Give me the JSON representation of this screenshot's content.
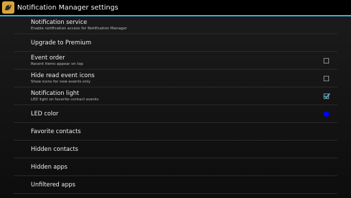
{
  "app": {
    "title": "Notification Manager settings",
    "icon": "app-logo-icon"
  },
  "settings": [
    {
      "key": "notification_service",
      "title": "Notification service",
      "summary": "Enable notification access for Notification Manager"
    },
    {
      "key": "upgrade",
      "title": "Upgrade to Premium"
    },
    {
      "key": "event_order",
      "title": "Event order",
      "summary": "Recent items appear on top",
      "control": "checkbox",
      "checked": false
    },
    {
      "key": "hide_read",
      "title": "Hide read event icons",
      "summary": "Show icons for new events only",
      "control": "checkbox",
      "checked": false
    },
    {
      "key": "notification_light",
      "title": "Notification light",
      "summary": "LED light on favorite contact events",
      "control": "checkbox",
      "checked": true
    },
    {
      "key": "led_color",
      "title": "LED color",
      "control": "color",
      "color": "#0000ff"
    },
    {
      "key": "favorite_contacts",
      "title": "Favorite contacts"
    },
    {
      "key": "hidden_contacts",
      "title": "Hidden contacts"
    },
    {
      "key": "hidden_apps",
      "title": "Hidden apps"
    },
    {
      "key": "unfiltered_apps",
      "title": "Unfiltered apps"
    }
  ],
  "colors": {
    "accent": "#33b5e5",
    "check": "#33b5e5",
    "led": "#0000ff"
  }
}
